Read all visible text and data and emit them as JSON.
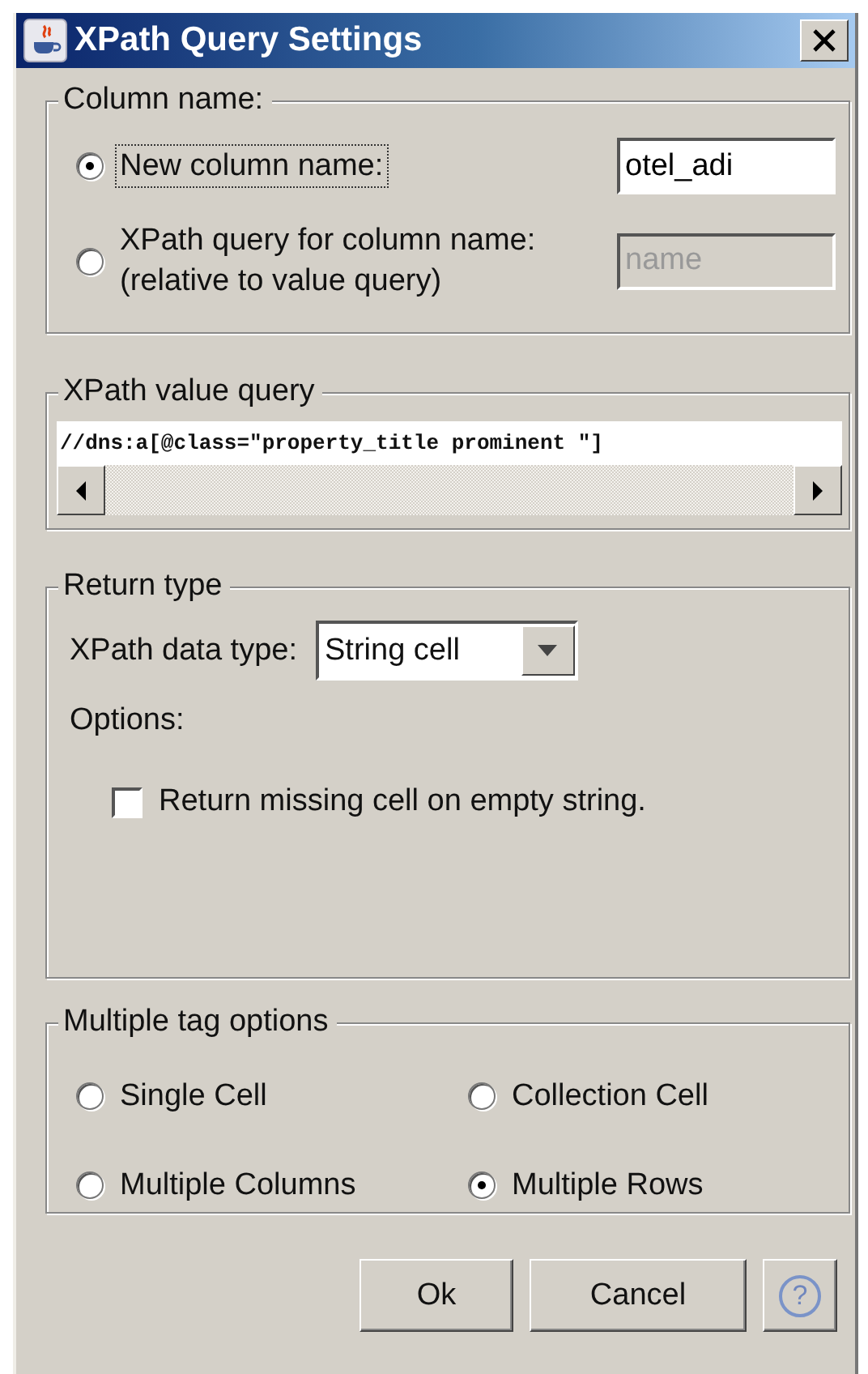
{
  "window": {
    "title": "XPath Query Settings"
  },
  "column_name": {
    "legend": "Column name:",
    "options": [
      {
        "label": "New column name:",
        "selected": true,
        "focused": true,
        "field": {
          "value": "otel_adi",
          "disabled": false
        }
      },
      {
        "label": "XPath query for column name:\n(relative to value query)",
        "selected": false,
        "focused": false,
        "field": {
          "value": "name",
          "disabled": true
        }
      }
    ]
  },
  "value_query": {
    "legend": "XPath value query",
    "value": "//dns:a[@class=\"property_title prominent \"]"
  },
  "return_type": {
    "legend": "Return type",
    "data_type_label": "XPath data type:",
    "data_type": "String cell",
    "options_label": "Options:",
    "checkboxes": [
      {
        "label": "Return missing cell on empty string.",
        "checked": false
      }
    ]
  },
  "multiple_tag": {
    "legend": "Multiple tag options",
    "options": [
      {
        "label": "Single Cell",
        "selected": false
      },
      {
        "label": "Collection Cell",
        "selected": false
      },
      {
        "label": "Multiple Columns",
        "selected": false
      },
      {
        "label": "Multiple Rows",
        "selected": true
      }
    ]
  },
  "buttons": [
    {
      "label": "Ok",
      "kind": "text"
    },
    {
      "label": "Cancel",
      "kind": "text"
    },
    {
      "label": "?",
      "kind": "help"
    }
  ]
}
